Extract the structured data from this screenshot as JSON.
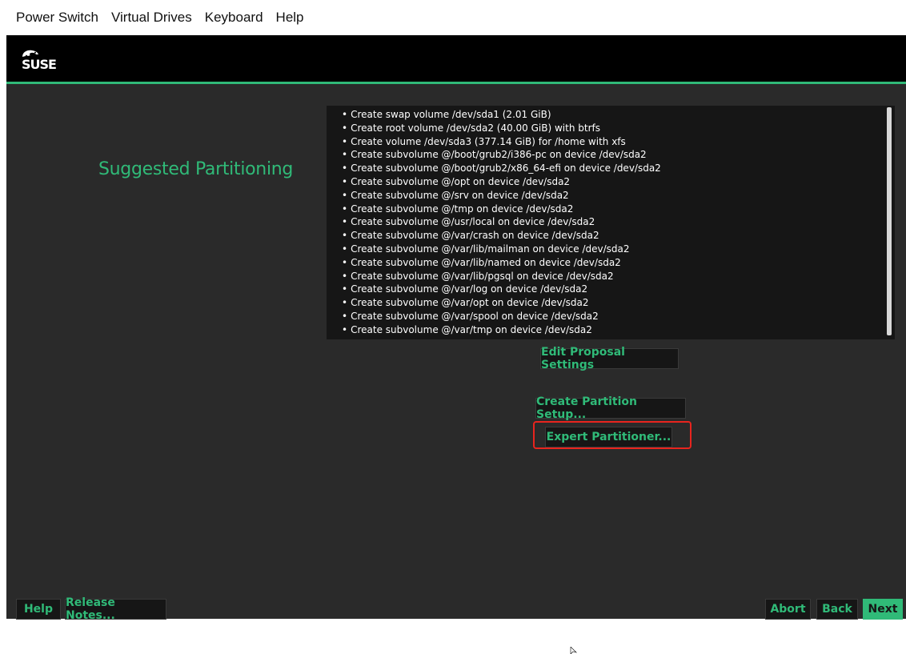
{
  "menubar": {
    "items": [
      "Power Switch",
      "Virtual Drives",
      "Keyboard",
      "Help"
    ]
  },
  "header": {
    "logo_text": "SUSE",
    "logo_icon": "suse-chameleon-icon"
  },
  "page": {
    "title": "Suggested Partitioning"
  },
  "summary": {
    "items": [
      "Create swap volume /dev/sda1 (2.01 GiB)",
      "Create root volume /dev/sda2 (40.00 GiB) with btrfs",
      "Create volume /dev/sda3 (377.14 GiB) for /home with xfs",
      "Create subvolume @/boot/grub2/i386-pc on device /dev/sda2",
      "Create subvolume @/boot/grub2/x86_64-efi on device /dev/sda2",
      "Create subvolume @/opt on device /dev/sda2",
      "Create subvolume @/srv on device /dev/sda2",
      "Create subvolume @/tmp on device /dev/sda2",
      "Create subvolume @/usr/local on device /dev/sda2",
      "Create subvolume @/var/crash on device /dev/sda2",
      "Create subvolume @/var/lib/mailman on device /dev/sda2",
      "Create subvolume @/var/lib/named on device /dev/sda2",
      "Create subvolume @/var/lib/pgsql on device /dev/sda2",
      "Create subvolume @/var/log on device /dev/sda2",
      "Create subvolume @/var/opt on device /dev/sda2",
      "Create subvolume @/var/spool on device /dev/sda2",
      "Create subvolume @/var/tmp on device /dev/sda2"
    ]
  },
  "buttons": {
    "edit_proposal": "Edit Proposal Settings",
    "create_setup": "Create Partition Setup...",
    "expert": "Expert Partitioner..."
  },
  "footer": {
    "help": "Help",
    "release_notes": "Release Notes...",
    "abort": "Abort",
    "back": "Back",
    "next": "Next"
  },
  "colors": {
    "accent": "#30ba78",
    "background": "#2a2a2a",
    "panel": "#161616",
    "highlight": "#e8241e"
  }
}
